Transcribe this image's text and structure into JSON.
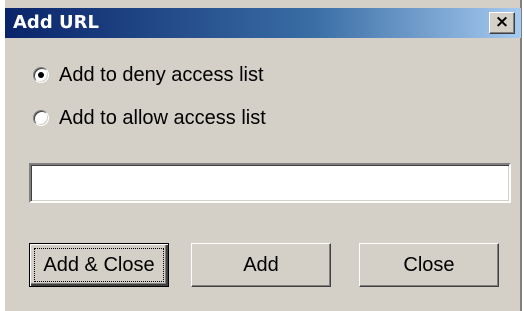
{
  "dialog": {
    "title": "Add URL",
    "close_glyph": "×"
  },
  "options": [
    {
      "label": "Add to deny access list",
      "selected": true
    },
    {
      "label": "Add to allow access list",
      "selected": false
    }
  ],
  "url_field": {
    "value": "",
    "placeholder": ""
  },
  "buttons": {
    "add_close": "Add & Close",
    "add": "Add",
    "close": "Close"
  },
  "icons": {
    "close": "close-icon"
  },
  "colors": {
    "title_start": "#0a246a",
    "title_end": "#a6caf0",
    "face": "#d4d0c8"
  }
}
